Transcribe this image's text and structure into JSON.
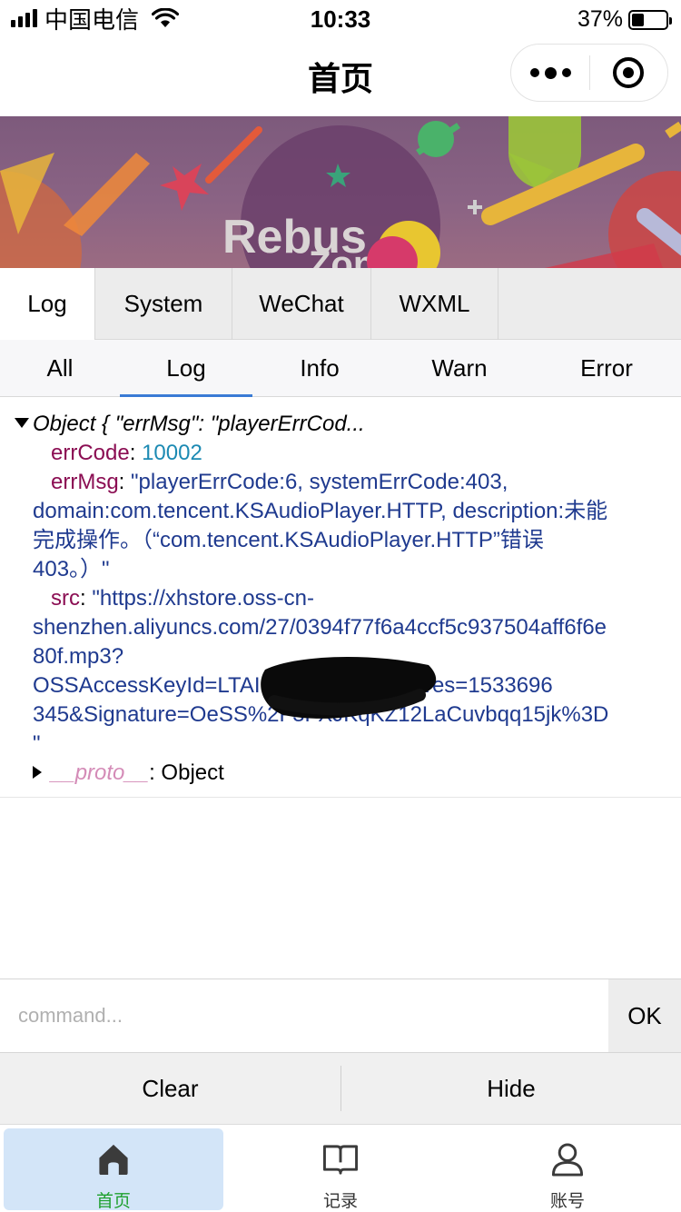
{
  "status_bar": {
    "carrier": "中国电信",
    "time": "10:33",
    "battery_percent": "37%",
    "battery_level": 0.37
  },
  "nav": {
    "title": "首页",
    "more_icon": "more-dots-icon",
    "close_icon": "target-close-icon"
  },
  "banner": {
    "text_line1": "Rebus",
    "text_line2": "Zone"
  },
  "top_tabs": [
    "Log",
    "System",
    "WeChat",
    "WXML"
  ],
  "top_tabs_active": "Log",
  "sub_tabs": [
    "All",
    "Log",
    "Info",
    "Warn",
    "Error"
  ],
  "sub_tabs_active": "Log",
  "log": {
    "object_header": "Object { \"errMsg\": \"playerErrCod...",
    "errCode_key": "errCode",
    "errCode_value": "10002",
    "errMsg_key": "errMsg",
    "errMsg_line1": "\"playerErrCode:6, systemErrCode:403,",
    "errMsg_line2": "domain:com.tencent.KSAudioPlayer.HTTP, description:未能",
    "errMsg_line3": "完成操作。（“com.tencent.KSAudioPlayer.HTTP”错误",
    "errMsg_line4": "403。）\"",
    "src_key": "src",
    "src_line1": "\"https://xhstore.oss-cn-",
    "src_line2": "shenzhen.aliyuncs.com/27/0394f77f6a4ccf5c937504aff6f6e",
    "src_line3": "80f.mp3?",
    "src_line4": "OSSAccessKeyId=LTAI           D0uMoKj1&Expires=1533696",
    "src_line5": "345&Signature=OeSS%2F3FXJKqKZ12LaCuvbqq15jk%3D",
    "src_line6": "\"",
    "proto_key": "__proto__",
    "proto_value": ": Object"
  },
  "command": {
    "placeholder": "command...",
    "ok_label": "OK"
  },
  "actions": {
    "clear_label": "Clear",
    "hide_label": "Hide"
  },
  "tabbar": {
    "items": [
      {
        "label": "首页",
        "icon": "home-icon",
        "active": true
      },
      {
        "label": "记录",
        "icon": "book-icon",
        "active": false
      },
      {
        "label": "账号",
        "icon": "user-icon",
        "active": false
      }
    ],
    "active_color": "#1ea02e",
    "active_bg": "#d3e5f8"
  }
}
